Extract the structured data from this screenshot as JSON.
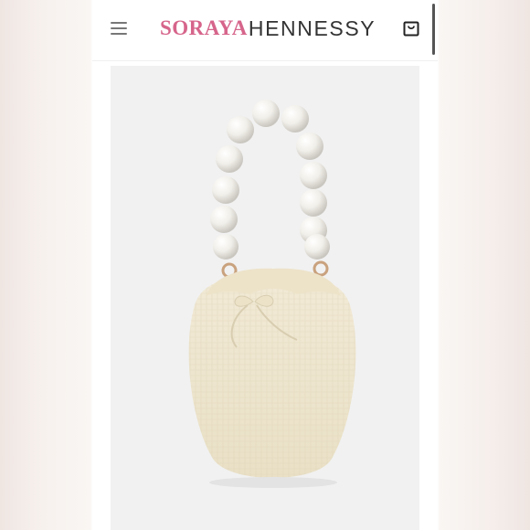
{
  "header": {
    "logo_first": "SORAYA",
    "logo_second": "HENNESSY",
    "menu_icon": "hamburger-menu-icon",
    "cart_icon": "shopping-bag-icon"
  },
  "product": {
    "image": "pearl-handle-straw-bucket-bag"
  },
  "colors": {
    "brand_pink": "#d6658b",
    "brand_dark": "#333333",
    "image_bg": "#f1f1f1"
  }
}
